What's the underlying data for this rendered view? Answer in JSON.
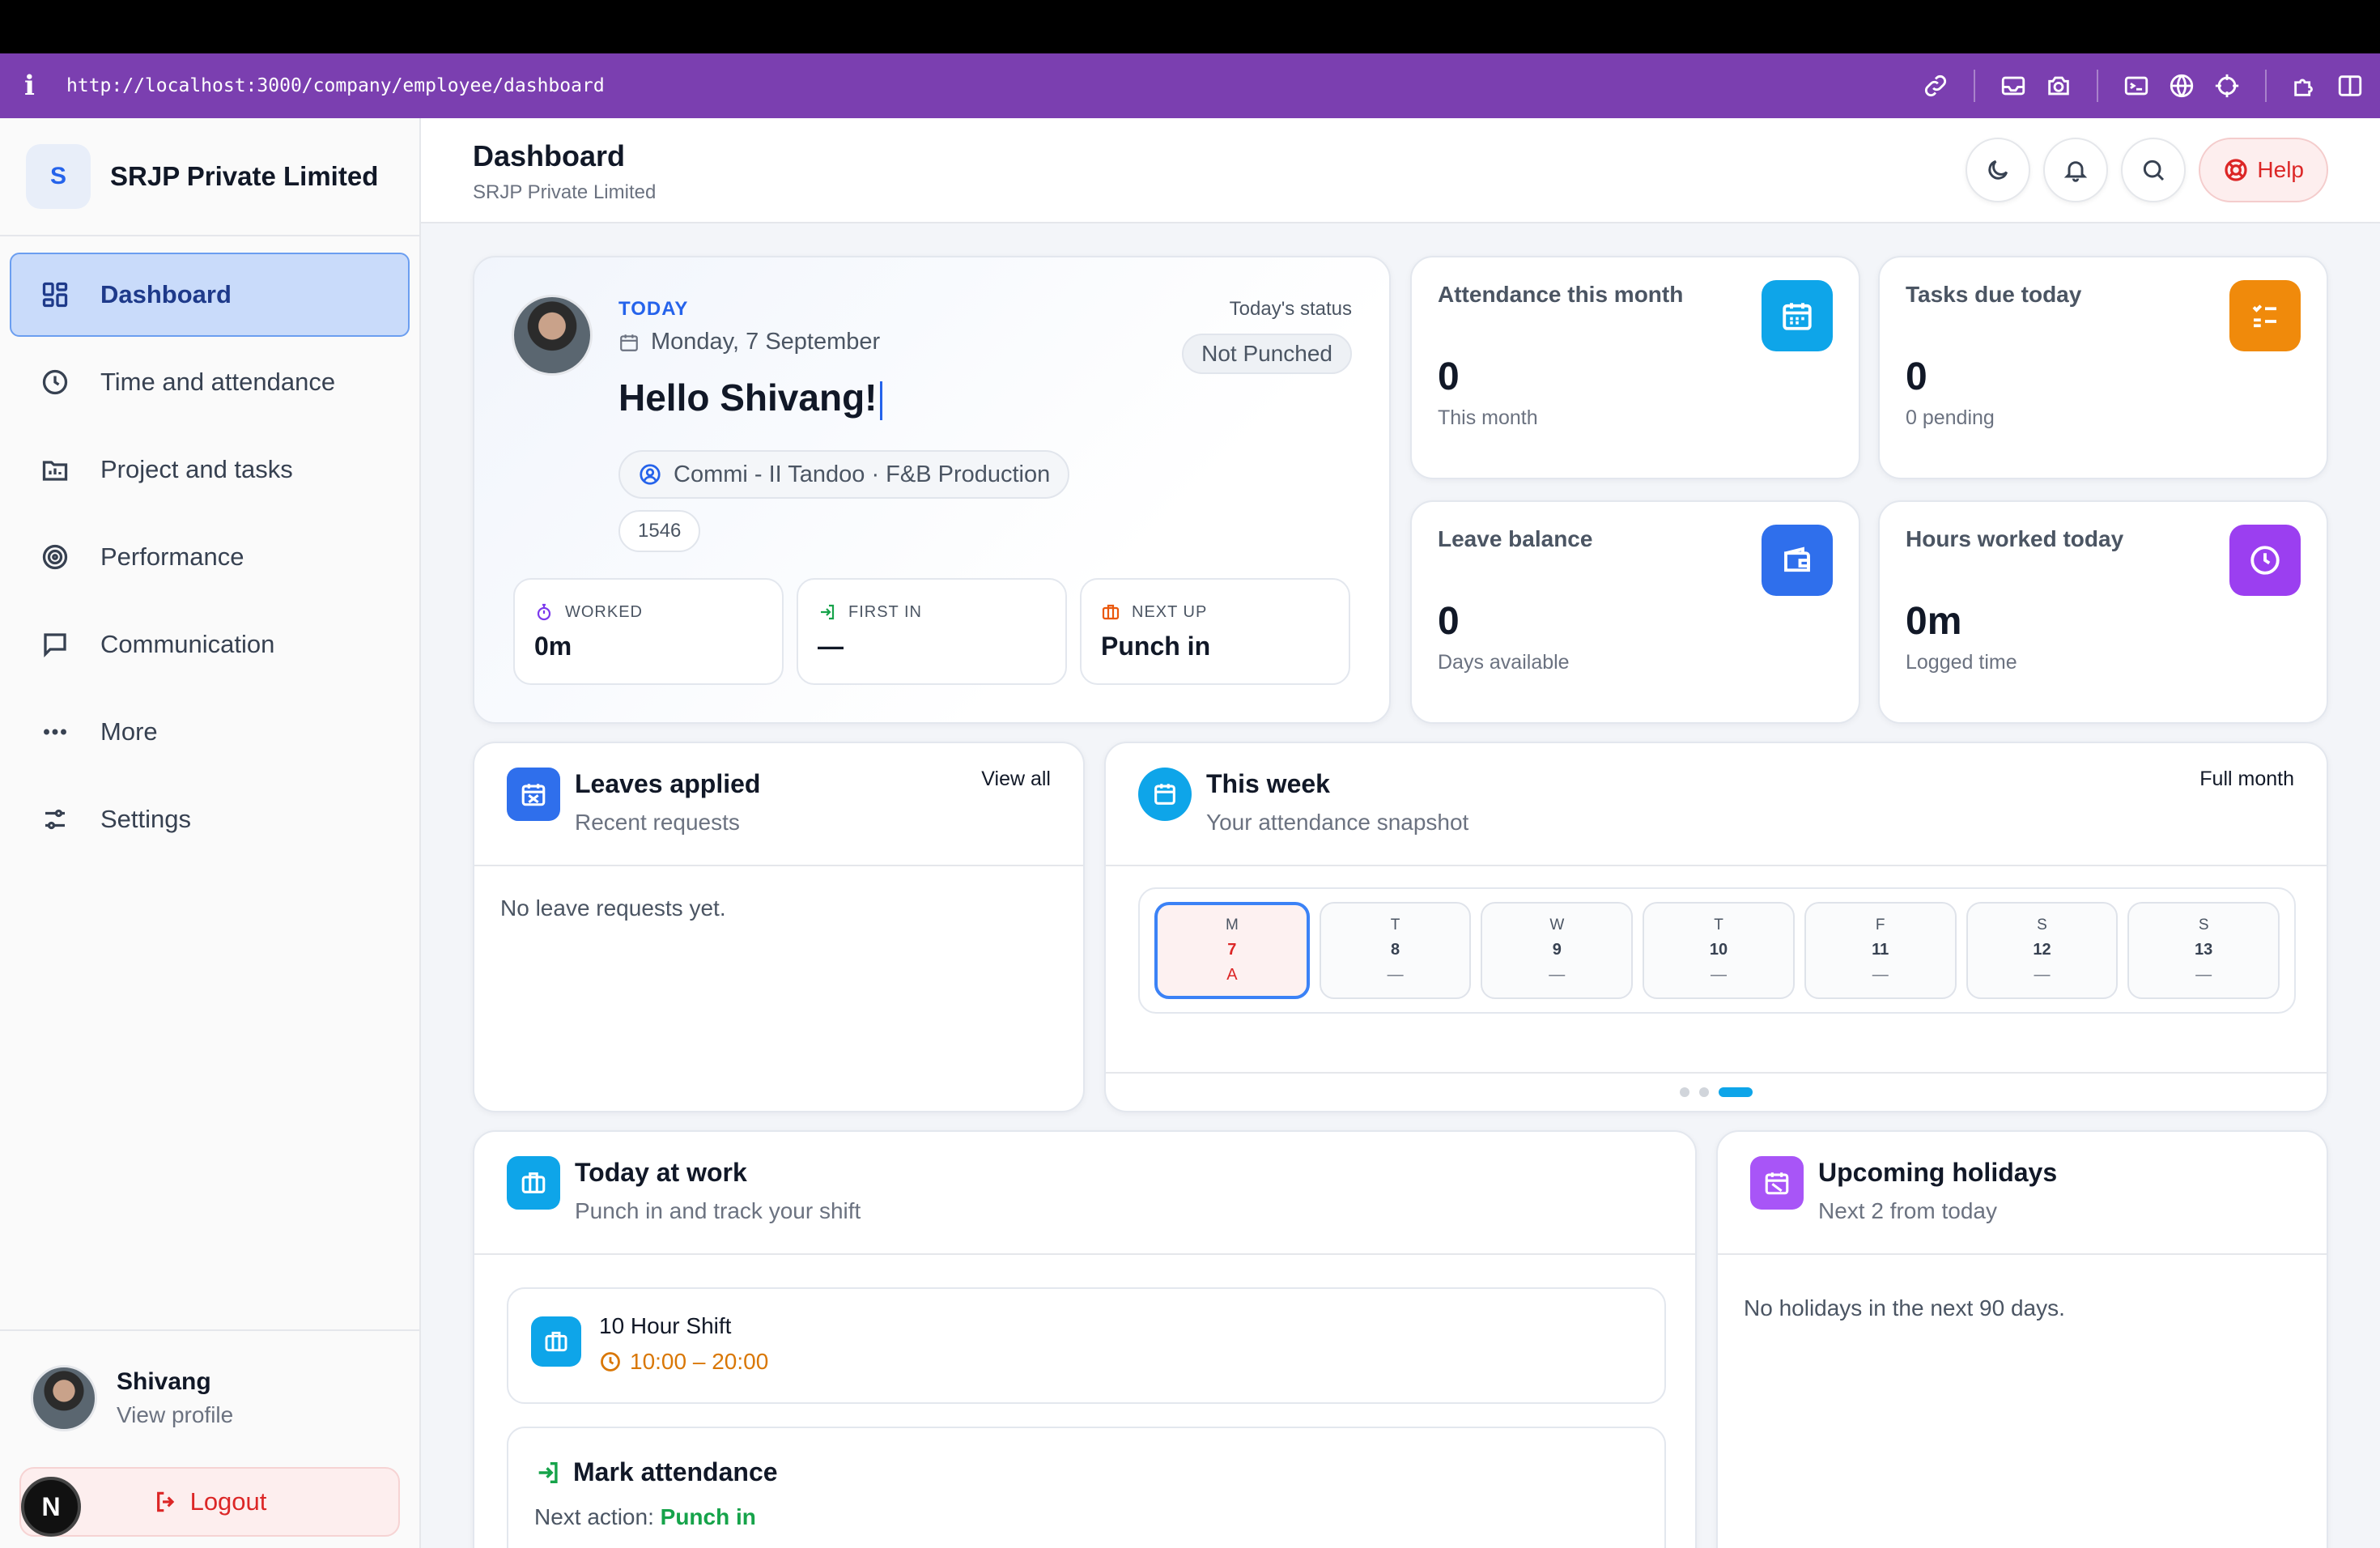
{
  "browser": {
    "url": "http://localhost:3000/company/employee/dashboard"
  },
  "brand": {
    "initial": "S",
    "name": "SRJP Private Limited"
  },
  "nav": [
    {
      "label": "Dashboard",
      "icon": "grid-icon"
    },
    {
      "label": "Time and attendance",
      "icon": "clock-icon"
    },
    {
      "label": "Project and tasks",
      "icon": "folder-chart-icon"
    },
    {
      "label": "Performance",
      "icon": "target-icon"
    },
    {
      "label": "Communication",
      "icon": "message-icon"
    },
    {
      "label": "More",
      "icon": "dots-icon"
    },
    {
      "label": "Settings",
      "icon": "sliders-icon"
    }
  ],
  "profile": {
    "name": "Shivang",
    "link": "View profile",
    "logout": "Logout",
    "badge": "N"
  },
  "header": {
    "title": "Dashboard",
    "subtitle": "SRJP Private Limited",
    "help": "Help"
  },
  "hello": {
    "today_label": "TODAY",
    "date": "Monday, 7 September",
    "greeting": "Hello Shivang!",
    "status_label": "Today's status",
    "status": "Not Punched",
    "role": "Commi - II Tandoo · F&B Production",
    "employee_id": "1546",
    "stats": [
      {
        "label": "WORKED",
        "value": "0m",
        "icon": "stopwatch-icon",
        "color": "#7c3aed"
      },
      {
        "label": "FIRST IN",
        "value": "—",
        "icon": "login-icon",
        "color": "#16a34a"
      },
      {
        "label": "NEXT UP",
        "value": "Punch in",
        "icon": "briefcase-icon",
        "color": "#ea580c"
      }
    ]
  },
  "kpis": [
    {
      "title": "Attendance this month",
      "value": "0",
      "sub": "This month",
      "color": "#0ea5e9",
      "icon": "calendar-icon"
    },
    {
      "title": "Tasks due today",
      "value": "0",
      "sub": "0 pending",
      "color": "#f08a0b",
      "icon": "checklist-icon"
    },
    {
      "title": "Leave balance",
      "value": "0",
      "sub": "Days available",
      "color": "#2f6fec",
      "icon": "wallet-icon"
    },
    {
      "title": "Hours worked today",
      "value": "0m",
      "sub": "Logged time",
      "color": "#9b3ff0",
      "icon": "clock-icon"
    }
  ],
  "leaves": {
    "title": "Leaves applied",
    "sub": "Recent requests",
    "link": "View all",
    "empty": "No leave requests yet.",
    "color": "#2f6fec"
  },
  "week": {
    "title": "This week",
    "sub": "Your attendance snapshot",
    "link": "Full month",
    "color": "#0ea5e9",
    "days": [
      {
        "d": "M",
        "n": "7",
        "m": "A"
      },
      {
        "d": "T",
        "n": "8",
        "m": "—"
      },
      {
        "d": "W",
        "n": "9",
        "m": "—"
      },
      {
        "d": "T",
        "n": "10",
        "m": "—"
      },
      {
        "d": "F",
        "n": "11",
        "m": "—"
      },
      {
        "d": "S",
        "n": "12",
        "m": "—"
      },
      {
        "d": "S",
        "n": "13",
        "m": "—"
      }
    ]
  },
  "work": {
    "title": "Today at work",
    "sub": "Punch in and track your shift",
    "color": "#0ea5e9",
    "shift_name": "10 Hour Shift",
    "shift_hours": "10:00 – 20:00",
    "mark_title": "Mark attendance",
    "mark_prefix": "Next action:",
    "mark_action": "Punch in"
  },
  "holidays": {
    "title": "Upcoming holidays",
    "sub": "Next 2 from today",
    "empty": "No holidays in the next 90 days.",
    "color": "#a855f7"
  }
}
